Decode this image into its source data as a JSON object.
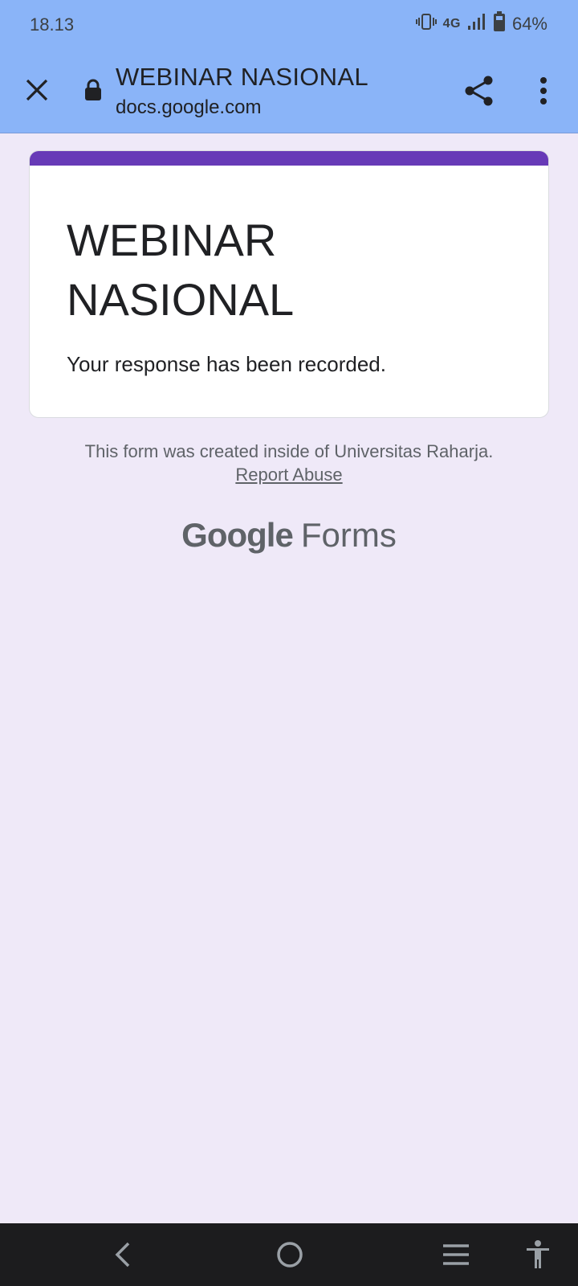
{
  "status_bar": {
    "time": "18.13",
    "network": "4G",
    "battery": "64%"
  },
  "custom_tab": {
    "title": "WEBINAR NASIONAL",
    "url": "docs.google.com"
  },
  "form": {
    "title": "WEBINAR NASIONAL",
    "confirmation": "Your response has been recorded."
  },
  "footer": {
    "note": "This form was created inside of Universitas Raharja.",
    "report_link": "Report Abuse",
    "brand_google": "Google",
    "brand_forms": "Forms"
  },
  "colors": {
    "topbar": "#8ab4f8",
    "background": "#efe9f8",
    "accent": "#673ab7",
    "navbar": "#1c1c1e"
  },
  "icons": [
    "vibrate-icon",
    "signal-icon",
    "battery-icon",
    "close-icon",
    "lock-icon",
    "share-icon",
    "more-vert-icon",
    "back-icon",
    "home-icon",
    "recents-icon",
    "accessibility-icon"
  ]
}
